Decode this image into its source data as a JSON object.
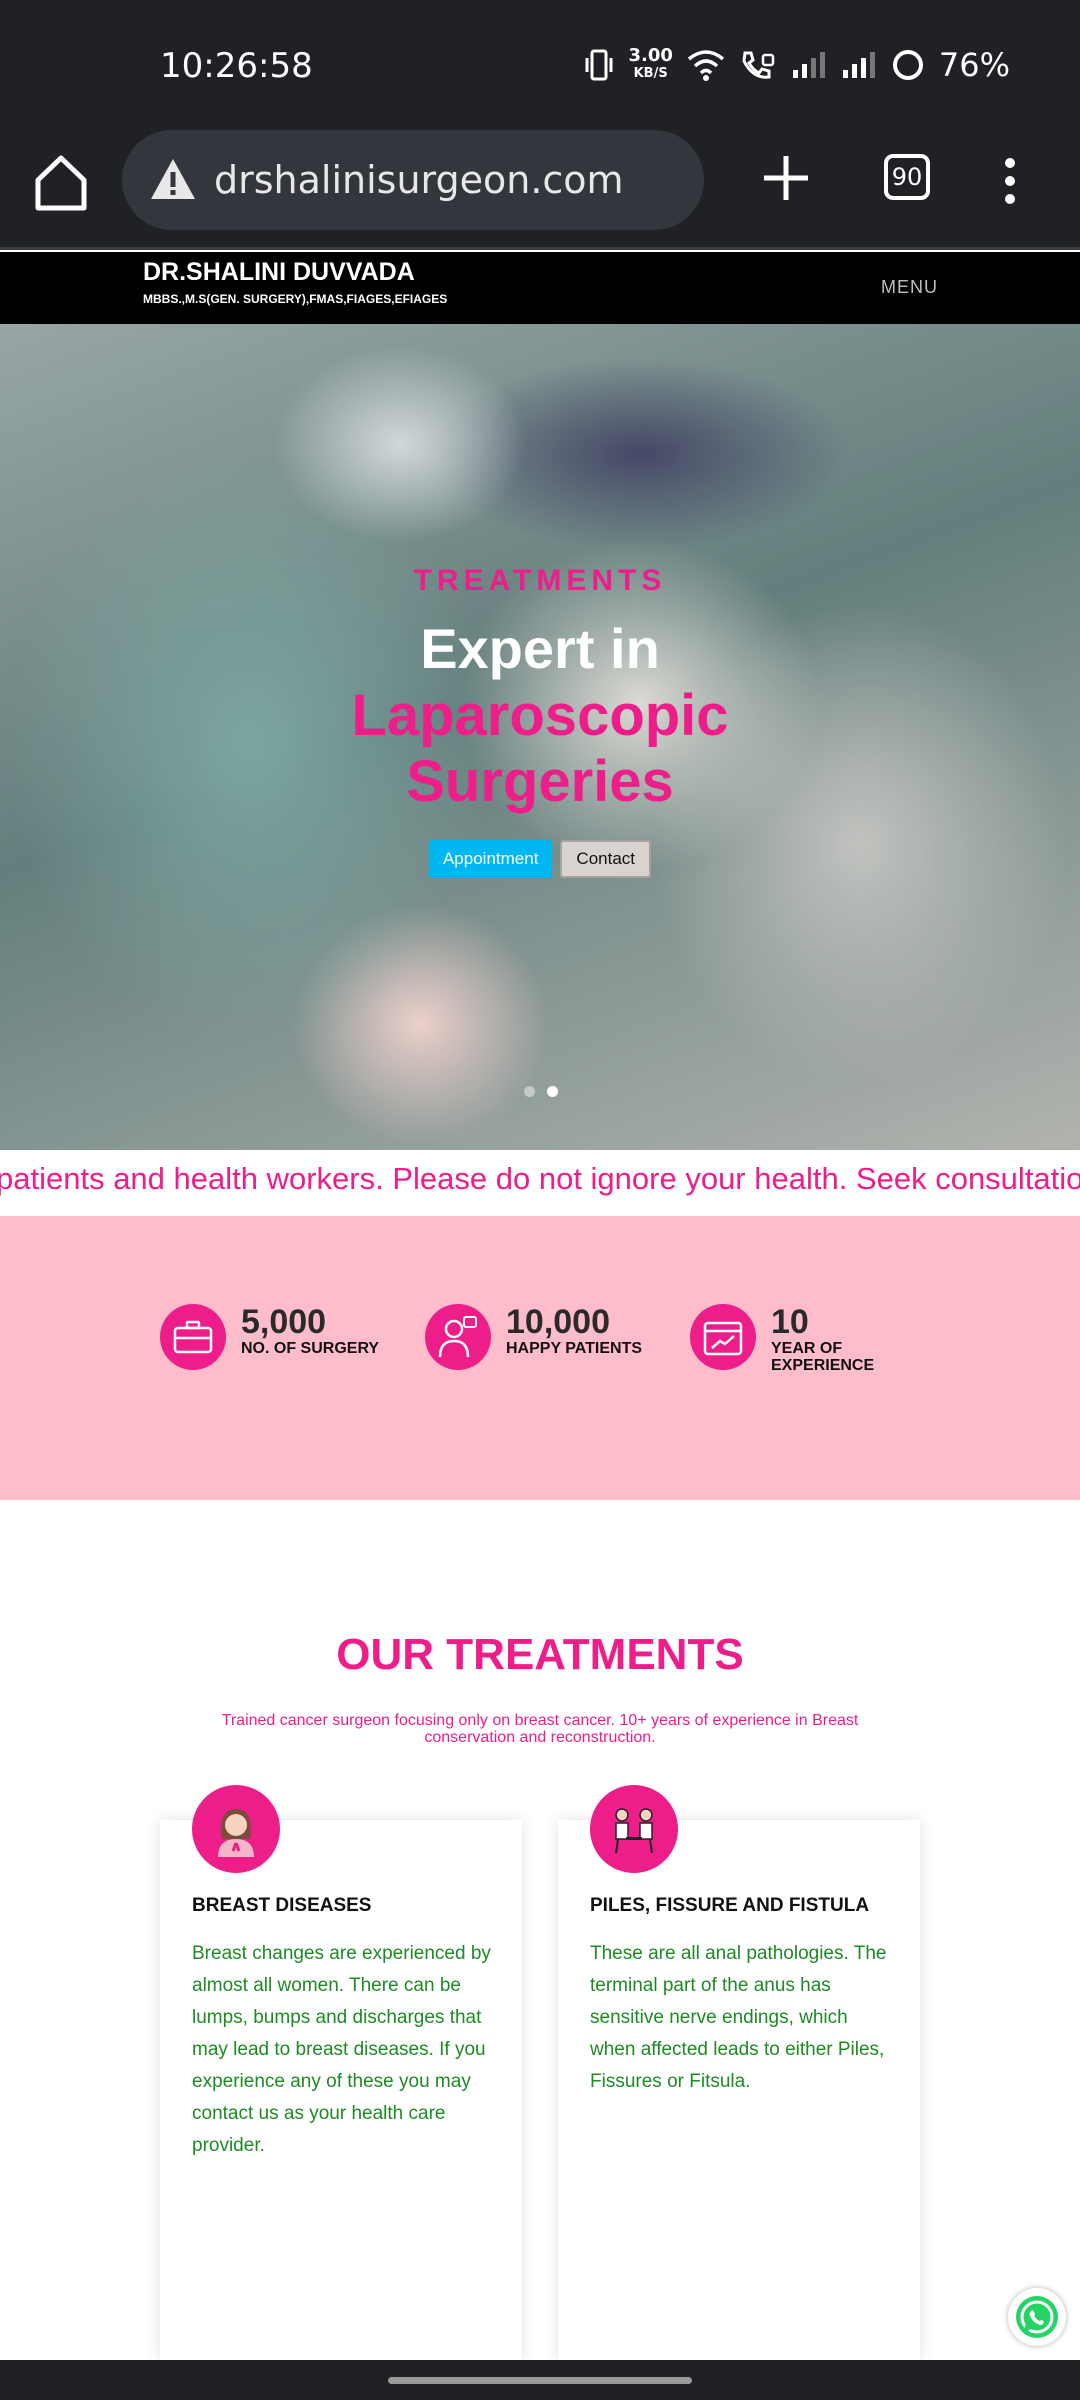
{
  "status_bar": {
    "time": "10:26:58",
    "net_speed_value": "3.00",
    "net_speed_unit": "KB/S",
    "battery": "76%",
    "icons": [
      "vibrate-icon",
      "wifi-icon",
      "call-icon",
      "signal-icon",
      "signal-icon",
      "battery-ring-icon"
    ]
  },
  "browser": {
    "url": "drshalinisurgeon.com",
    "tab_count": "90"
  },
  "site_header": {
    "name": "DR.SHALINI DUVVADA",
    "qualifications": "MBBS.,M.S(GEN. SURGERY),FMAS,FIAGES,EFIAGES",
    "menu_label": "MENU"
  },
  "hero": {
    "eyebrow": "TREATMENTS",
    "line1": "Expert in",
    "line2": "Laparoscopic",
    "line3": "Surgeries",
    "appointment_label": "Appointment",
    "contact_label": "Contact",
    "slides_total": 2,
    "active_slide": 2
  },
  "ticker": {
    "text": "patients and health workers. Please do not ignore your health. Seek consultation"
  },
  "stats": [
    {
      "value": "5,000",
      "label": "NO. OF SURGERY",
      "icon": "briefcase-icon"
    },
    {
      "value": "10,000",
      "label": "HAPPY PATIENTS",
      "icon": "doctor-icon"
    },
    {
      "value": "10",
      "label": "YEAR OF EXPERIENCE",
      "icon": "calendar-chart-icon"
    }
  ],
  "treatments": {
    "title": "OUR TREATMENTS",
    "subtitle": "Trained cancer surgeon focusing only on breast cancer. 10+ years of experience in Breast conservation and reconstruction.",
    "cards": [
      {
        "title": "BREAST DISEASES",
        "body": "Breast changes are experienced by almost all women. There can be lumps, bumps and discharges that may lead to breast diseases. If you experience any of these you may contact us as your health care provider.",
        "icon": "woman-ribbon-icon"
      },
      {
        "title": "PILES, FISSURE AND FISTULA",
        "body": "These are all anal pathologies. The terminal part of the anus has sensitive nerve endings, which when affected leads to either Piles, Fissures or Fitsula.",
        "icon": "doctor-patient-icon"
      }
    ]
  },
  "colors": {
    "accent_pink": "#ed1e8a",
    "stats_bg": "#ffbccb",
    "appointment_blue": "#00b7f1",
    "body_green": "#1f8a24"
  }
}
